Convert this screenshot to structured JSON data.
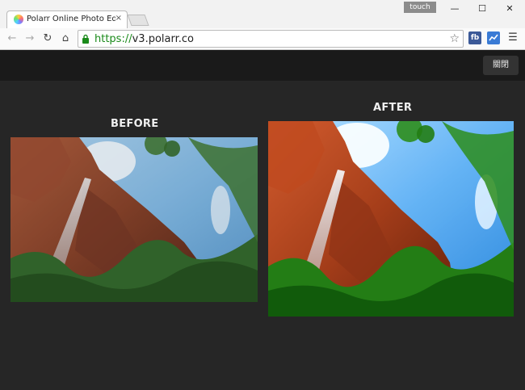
{
  "browser": {
    "tab_title": "Polarr Online Photo Edit",
    "tab_close": "×",
    "touch_label": "touch",
    "minimize": "—",
    "maximize": "☐",
    "close": "✕",
    "url_scheme": "https://",
    "url_host": "v3.polarr.co",
    "ext_fb": "fb"
  },
  "app": {
    "close_button_label": "關閉",
    "before_label": "BEFORE",
    "after_label": "AFTER"
  },
  "colors": {
    "accent_green": "#1a8a1a",
    "app_background": "#262626"
  }
}
